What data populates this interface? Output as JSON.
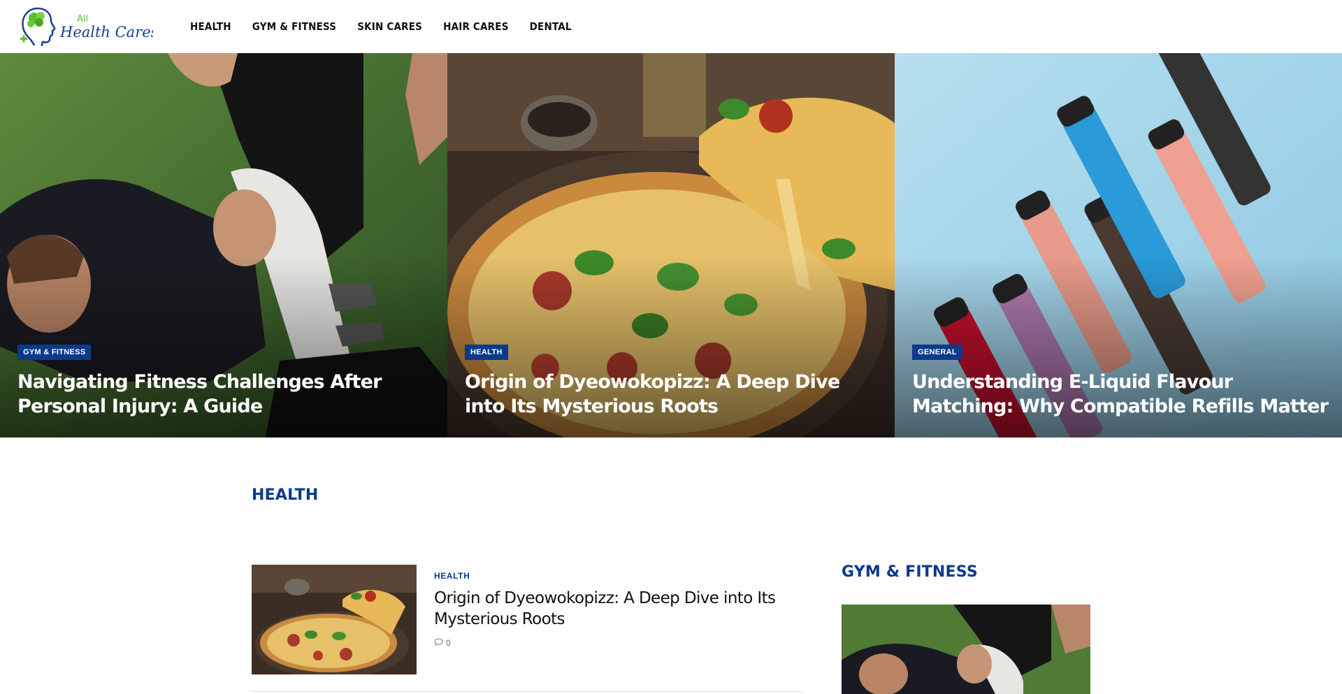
{
  "site": {
    "logo_text_all": "All",
    "logo_text_main": "Health Cares"
  },
  "nav": {
    "items": [
      {
        "label": "HEALTH"
      },
      {
        "label": "GYM & FITNESS"
      },
      {
        "label": "SKIN CARES"
      },
      {
        "label": "HAIR CARES"
      },
      {
        "label": "DENTAL"
      }
    ]
  },
  "hero": {
    "cards": [
      {
        "category": "GYM & FITNESS",
        "title": "Navigating Fitness Challenges After Personal Injury: A Guide"
      },
      {
        "category": "HEALTH",
        "title": "Origin of Dyeowokopizz: A Deep Dive into Its Mysterious Roots"
      },
      {
        "category": "GENERAL",
        "title": "Understanding E-Liquid Flavour Matching: Why Compatible Refills Matter"
      }
    ]
  },
  "health_section": {
    "title": "HEALTH",
    "post": {
      "category": "HEALTH",
      "title": "Origin of Dyeowokopizz: A Deep Dive into Its Mysterious Roots",
      "comments": "0"
    }
  },
  "gym_section": {
    "title": "GYM & FITNESS"
  },
  "colors": {
    "accent": "#0b3a8c",
    "logo_green": "#5bbf2a"
  }
}
